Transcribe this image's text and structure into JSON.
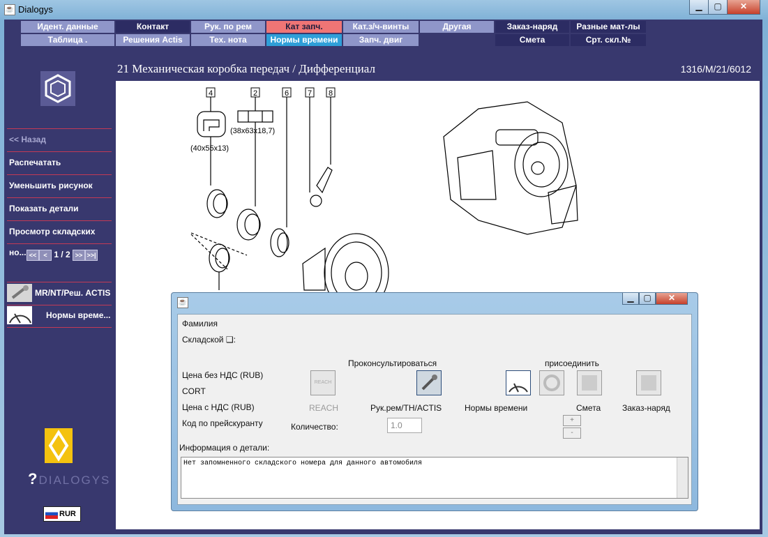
{
  "window": {
    "title": "Dialogys",
    "min": "▁",
    "max": "▢",
    "close": "✕"
  },
  "tabs_row1": [
    "Идент. данные",
    "Контакт",
    "Рук. по рем",
    "Кат запч.",
    "Кат.з/ч-винты",
    "Другая",
    "Заказ-наряд",
    "Разные мат-лы"
  ],
  "tabs_row2": [
    "Таблица .",
    "Решения Actis",
    "Тех. нота",
    "Нормы времени",
    "Запч. двиг",
    "",
    "Смета",
    "Срт. скл.№"
  ],
  "sidebar": {
    "items": [
      "<< Назад",
      "Распечатать",
      "Уменьшить рисунок",
      "Показать детали",
      "Просмотр складских но..."
    ],
    "pager": {
      "first": "<<",
      "prev": "<",
      "text": "1 / 2",
      "next": ">>",
      "last": ">>|"
    },
    "links": [
      "MR/NT/Реш. ACTIS",
      "Нормы време..."
    ],
    "brand": "DIALOGYS",
    "currency": "RUR"
  },
  "header": {
    "title": "21 Механическая коробка передач / Дифференциал",
    "ref": "1316/M/21/6012"
  },
  "diagram": {
    "callouts": [
      "4",
      "2",
      "6",
      "7",
      "8"
    ],
    "dims": [
      "(40x55x13)",
      "(38x63x18,7)"
    ]
  },
  "dialog": {
    "surname_label": "Фамилия",
    "stock_label": "Складской ❑:",
    "price_no_vat": "Цена без НДС (RUB)",
    "cort": "CORT",
    "price_vat": "Цена с НДС (RUB)",
    "price_code": "Код по прейскуранту",
    "consult_label": "Проконсультироваться",
    "attach_label": "присоединить",
    "reach": "REACH",
    "reach_icon_text": "REACH",
    "manual": "Рук.рем/TH/ACTIS",
    "labor": "Нормы времени",
    "estimate": "Смета",
    "order": "Заказ-наряд",
    "qty_label": "Количество:",
    "qty_value": "1.0",
    "plus": "+",
    "minus": "-",
    "info_label": "Информация о детали:",
    "info_text": "Нет запомненного складского номера для данного автомобиля"
  }
}
